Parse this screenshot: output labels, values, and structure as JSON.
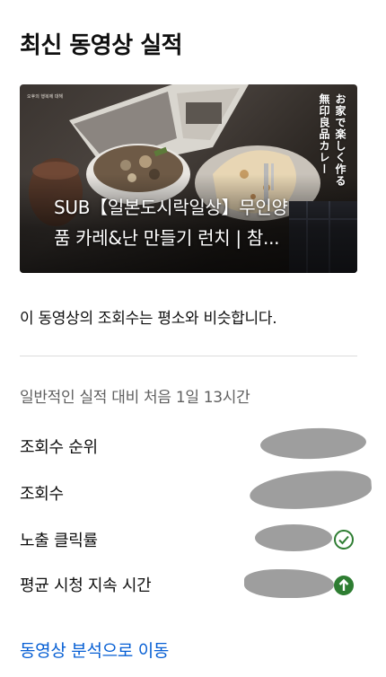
{
  "header": {
    "title": "최신 동영상 실적"
  },
  "video": {
    "title_line1": "SUB【일본도시락일상】무인양",
    "title_line2": "품 카레&난 만들기 런치 | 참...",
    "thumbnail_caption_line1": "오후의 행복에 대해",
    "thumbnail_caption_line2": "",
    "thumbnail_vertical_text": [
      "お家で楽しく作る",
      "無印良品カレー"
    ]
  },
  "summary": {
    "text": "이 동영상의 조회수는 평소와 비슷합니다."
  },
  "comparison": {
    "text": "일반적인 실적 대비 처음 1일 13시간"
  },
  "metrics": [
    {
      "label": "조회수 순위",
      "value_redacted": true,
      "status_icon": null
    },
    {
      "label": "조회수",
      "value_redacted": true,
      "status_icon": null
    },
    {
      "label": "노출 클릭률",
      "value_redacted": true,
      "status_icon": "check-circle-icon"
    },
    {
      "label": "평균 시청 지속 시간",
      "value_redacted": true,
      "status_icon": "arrow-up-circle-icon"
    }
  ],
  "action": {
    "link_label": "동영상 분석으로 이동"
  },
  "colors": {
    "link": "#065fd4",
    "status_green": "#2e7d32",
    "redaction": "#9e9e9e",
    "divider": "#dcdcdc"
  }
}
